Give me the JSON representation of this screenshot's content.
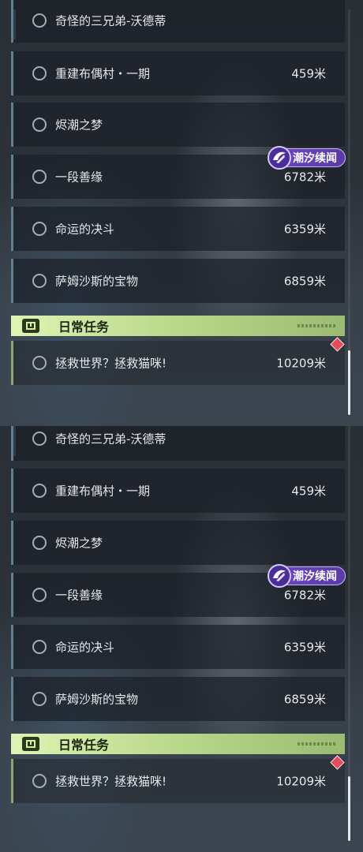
{
  "quests": [
    {
      "name": "奇怪的三兄弟-沃德蒂",
      "distance": ""
    },
    {
      "name": "重建布偶村・一期",
      "distance": "459米"
    },
    {
      "name": "烬潮之梦",
      "distance": ""
    },
    {
      "name": "一段善缘",
      "distance": "6782米"
    },
    {
      "name": "命运的决斗",
      "distance": "6359米"
    },
    {
      "name": "萨姆沙斯的宝物",
      "distance": "6859米"
    }
  ],
  "event_badge": {
    "label": "潮汐续闻",
    "icon": "tide-emblem-icon",
    "color": "#6c48c6"
  },
  "daily": {
    "header": "日常任务",
    "icon": "exclamation-icon",
    "quest": {
      "name": "拯救世界？拯救猫咪!",
      "distance": "10209米"
    },
    "marker_color": "#e24e5e"
  },
  "colors": {
    "main_quest_accent": "#5f7f95",
    "daily_accent": "#b8d88a"
  }
}
